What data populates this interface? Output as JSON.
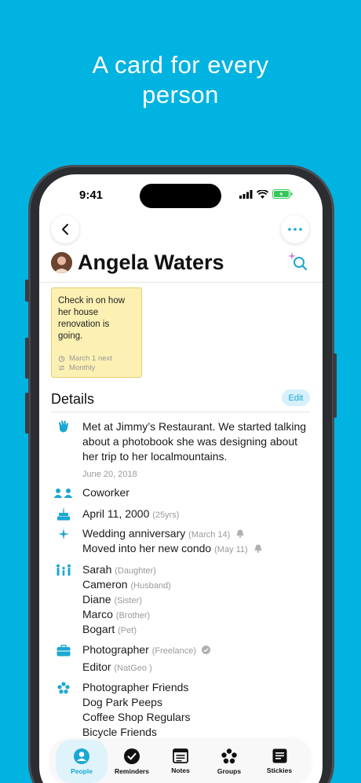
{
  "headline": [
    "A card for every",
    "person"
  ],
  "status": {
    "time": "9:41"
  },
  "contact": {
    "name": "Angela Waters"
  },
  "sticky": {
    "text": "Check in on how her house renovation is going.",
    "date": "March 1 next",
    "repeat": "Monthly"
  },
  "details": {
    "title": "Details",
    "edit_label": "Edit",
    "met_note": "Met at Jimmy’s Restaurant. We started talking about a photobook she was designing about her trip to her localmountains.",
    "met_date": "June 20, 2018",
    "relationship": "Coworker",
    "birthday": "April 11, 2000",
    "age": "(25yrs)",
    "events": [
      {
        "label": "Wedding anniversary",
        "date": "(March 14)"
      },
      {
        "label": "Moved into her new condo",
        "date": "(May 11)"
      }
    ],
    "family": [
      {
        "name": "Sarah",
        "relation": "(Daughter)"
      },
      {
        "name": "Cameron",
        "relation": "(Husband)"
      },
      {
        "name": "Diane",
        "relation": "(Sister)"
      },
      {
        "name": "Marco",
        "relation": "(Brother)"
      },
      {
        "name": "Bogart",
        "relation": "(Pet)"
      }
    ],
    "jobs": [
      {
        "title": "Photographer",
        "org": "(Freelance)"
      },
      {
        "title": "Editor",
        "org": "(NatGeo )"
      }
    ],
    "groups": [
      "Photographer Friends",
      "Dog Park Peeps",
      "Coffee Shop Regulars",
      "Bicycle Friends"
    ]
  },
  "tabs": [
    {
      "label": "People",
      "icon": "person-icon",
      "active": true
    },
    {
      "label": "Reminders",
      "icon": "checkmark-icon",
      "active": false
    },
    {
      "label": "Notes",
      "icon": "notes-icon",
      "active": false
    },
    {
      "label": "Groups",
      "icon": "groups-icon",
      "active": false
    },
    {
      "label": "Stickies",
      "icon": "stickies-icon",
      "active": false
    }
  ],
  "colors": {
    "background": "#00b3e0",
    "accent": "#1ba7d3",
    "sticky": "#fcf0b3"
  }
}
